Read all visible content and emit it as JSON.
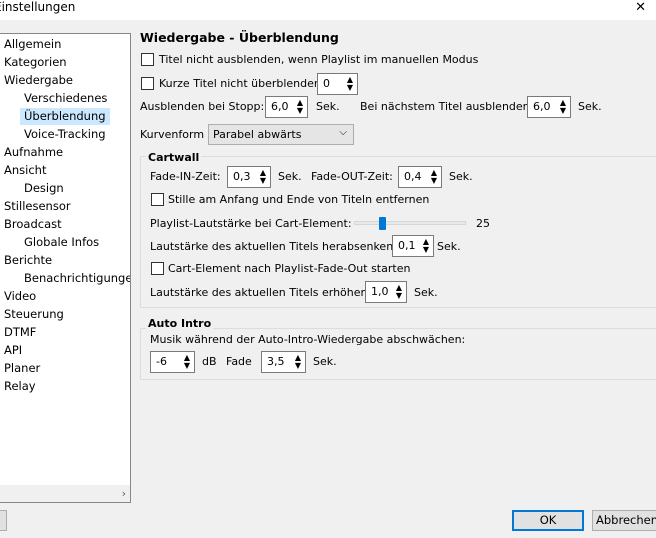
{
  "window": {
    "title": "Einstellungen",
    "close_glyph": "✕"
  },
  "sidebar": {
    "items": [
      {
        "label": "Allgemein",
        "level": 0
      },
      {
        "label": "Kategorien",
        "level": 0
      },
      {
        "label": "Wiedergabe",
        "level": 0
      },
      {
        "label": "Verschiedenes",
        "level": 1
      },
      {
        "label": "Überblendung",
        "level": 1,
        "selected": true
      },
      {
        "label": "Voice-Tracking",
        "level": 1
      },
      {
        "label": "Aufnahme",
        "level": 0
      },
      {
        "label": "Ansicht",
        "level": 0
      },
      {
        "label": "Design",
        "level": 1
      },
      {
        "label": "Stillesensor",
        "level": 0
      },
      {
        "label": "Broadcast",
        "level": 0
      },
      {
        "label": "Globale Infos",
        "level": 1
      },
      {
        "label": "Berichte",
        "level": 0
      },
      {
        "label": "Benachrichtigungen",
        "level": 1
      },
      {
        "label": "Video",
        "level": 0
      },
      {
        "label": "Steuerung",
        "level": 0
      },
      {
        "label": "DTMF",
        "level": 0
      },
      {
        "label": "API",
        "level": 0
      },
      {
        "label": "Planer",
        "level": 0
      },
      {
        "label": "Relay",
        "level": 0
      }
    ],
    "scroll_right_glyph": "›"
  },
  "page": {
    "title": "Wiedergabe - Überblendung",
    "opt_no_hide_titles": "Titel nicht ausblenden, wenn Playlist im manuellen Modus",
    "opt_short_titles": "Kurze Titel nicht überblenden",
    "short_titles_value": "0",
    "fade_stop_label": "Ausblenden bei Stopp:",
    "fade_stop_value": "6,0",
    "fade_stop_unit": "Sek.",
    "fade_next_label": "Bei nächstem Titel ausblenden",
    "fade_next_value": "6,0",
    "fade_next_unit": "Sek.",
    "curve_label": "Kurvenform",
    "curve_value": "Parabel abwärts"
  },
  "cartwall": {
    "title": "Cartwall",
    "fade_in_label": "Fade-IN-Zeit:",
    "fade_in_value": "0,3",
    "fade_in_unit": "Sek.",
    "fade_out_label": "Fade-OUT-Zeit:",
    "fade_out_value": "0,4",
    "fade_out_unit": "Sek.",
    "opt_remove_silence": "Stille am Anfang und Ende von Titeln entfernen",
    "volume_label": "Playlist-Lautstärke bei Cart-Element:",
    "volume_value": "25",
    "volume_fraction": 0.25,
    "lower_label": "Lautstärke des aktuellen Titels herabsenken:",
    "lower_value": "0,1",
    "lower_unit": "Sek.",
    "opt_start_after_fade": "Cart-Element nach Playlist-Fade-Out starten",
    "raise_label": "Lautstärke des aktuellen Titels erhöhen:",
    "raise_value": "1,0",
    "raise_unit": "Sek."
  },
  "auto_intro": {
    "title": "Auto Intro",
    "label": "Musik während der Auto-Intro-Wiedergabe abschwächen:",
    "db_value": "-6",
    "db_unit": "dB",
    "fade_label": "Fade",
    "fade_value": "3,5",
    "fade_unit": "Sek."
  },
  "footer": {
    "ok": "OK",
    "cancel": "Abbrechen"
  },
  "glyphs": {
    "spin_up": "▲",
    "spin_down": "▼",
    "combo_arrow": "⌵"
  }
}
